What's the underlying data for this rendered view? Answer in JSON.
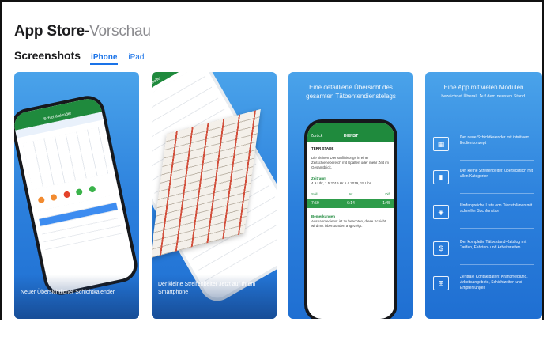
{
  "header": {
    "title_bold": "App Store-",
    "title_light": "Vorschau"
  },
  "screenshots": {
    "label": "Screenshots",
    "tabs": [
      {
        "label": "iPhone",
        "active": true
      },
      {
        "label": "iPad",
        "active": false
      }
    ]
  },
  "cards": [
    {
      "caption": "Neuer Übersichtlicher Schichtkalender",
      "screen_bar": "Schichtkalender"
    },
    {
      "caption": "Der kleine Streifenbelter Jetzt auf Ihrem Smartphone",
      "screen_bar": "Streifenbelter"
    },
    {
      "heading": "Eine detaillierte Übersicht des gesamten Tätbentendienstelags",
      "screen": {
        "bar_left": "Zurück",
        "bar_title": "DIENST",
        "row_title": "TERR STADE",
        "body_text": "Die kleinen Dienstüffnisongs in einer Zeitschienebereich mit Spalten oder mehr Zeit im Gesamtblick.",
        "section_label": "Zeitraum",
        "section_value": "4.9 Uhr, 1.5.2019 Hr 6.4.2019, 15 Uhr",
        "table_headers": [
          "Soll",
          "Ist",
          "Diff"
        ],
        "table_values": [
          "7:59",
          "6:14",
          "1:45"
        ],
        "notes_label": "Bemerkungen",
        "notes_text": "Ausnahmedienst ist zu beachten, diese Schicht wird mit Überstunden angezeigt."
      }
    },
    {
      "heading": "Eine App mit vielen Modulen",
      "subheading": "bezeichnet Überall. Auf dem neusten Stand.",
      "features": [
        {
          "icon": "calendar-icon",
          "glyph": "▦",
          "text": "Der neue Schichtkalender mit intuitivem Bedienkonzept"
        },
        {
          "icon": "document-icon",
          "glyph": "▮",
          "text": "Der kleine Streifenbelter, übersichtlich mit allen Kategorien"
        },
        {
          "icon": "shield-icon",
          "glyph": "◈",
          "text": "Umfangreiche Liste von Dienstplänen mit schneller Suchfunktion"
        },
        {
          "icon": "dollar-icon",
          "glyph": "$",
          "text": "Der komplette Tätbestand-Katalog mit Tarifen, Fahrten- und Arbeitszeiten"
        },
        {
          "icon": "contacts-icon",
          "glyph": "⊞",
          "text": "Zentrale Kontaktdaten: Krankmeldung, Arbeitsangebote, Schichtzeiten und Empfehlungen"
        }
      ]
    }
  ],
  "colors": {
    "card_gradient_top": "#4aa3ea",
    "card_gradient_bottom": "#1f6fd2",
    "app_green": "#1f8a3d",
    "link_blue": "#1a73e8"
  }
}
